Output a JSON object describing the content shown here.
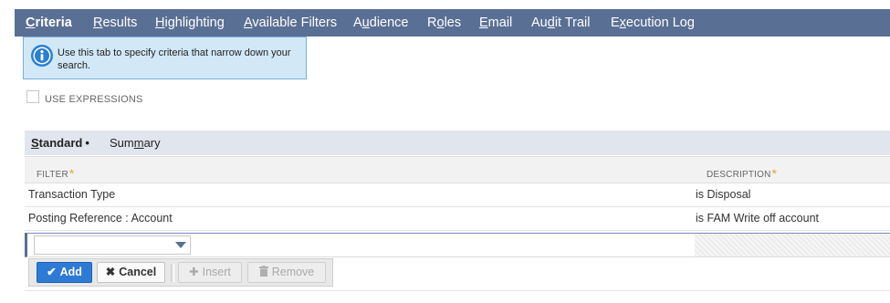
{
  "tabs": [
    {
      "label": "Criteria",
      "underline": "C",
      "rest": "riteria",
      "active": true
    },
    {
      "label": "Results",
      "underline": "R",
      "rest": "esults"
    },
    {
      "label": "Highlighting",
      "underline": "H",
      "rest": "ighlighting"
    },
    {
      "label": "Available Filters",
      "underline": "A",
      "rest": "vailable Filters"
    },
    {
      "label": "Audience",
      "pre": "A",
      "underline": "u",
      "rest": "dience"
    },
    {
      "label": "Roles",
      "pre": "R",
      "underline": "o",
      "rest": "les"
    },
    {
      "label": "Email",
      "underline": "E",
      "rest": "mail"
    },
    {
      "label": "Audit Trail",
      "pre": "Au",
      "underline": "d",
      "rest": "it Trail"
    },
    {
      "label": "Execution Log",
      "pre": "E",
      "underline": "x",
      "rest": "ecution Log"
    }
  ],
  "info": {
    "text": "Use this tab to specify criteria that narrow down your search.",
    "icon": "info-icon"
  },
  "use_expressions": {
    "label": "USE EXPRESSIONS",
    "checked": false
  },
  "subtabs": {
    "standard": {
      "underline": "S",
      "rest": "tandard",
      "dot": "•"
    },
    "summary": {
      "pre": "Sum",
      "underline": "m",
      "rest": "ary"
    }
  },
  "table": {
    "headers": {
      "filter": "FILTER",
      "description": "DESCRIPTION",
      "required_mark": "*"
    },
    "rows": [
      {
        "filter": "Transaction Type",
        "description": "is Disposal"
      },
      {
        "filter": "Posting Reference : Account",
        "description": "is FAM Write off account"
      }
    ],
    "new_row_filter_value": ""
  },
  "buttons": {
    "add": "Add",
    "cancel": "Cancel",
    "insert": "Insert",
    "remove": "Remove"
  },
  "colors": {
    "tabbar": "#5a6f94",
    "info_bg": "#d2e8f7",
    "add_button": "#2e7bd6",
    "required_star": "#e8a33d"
  }
}
